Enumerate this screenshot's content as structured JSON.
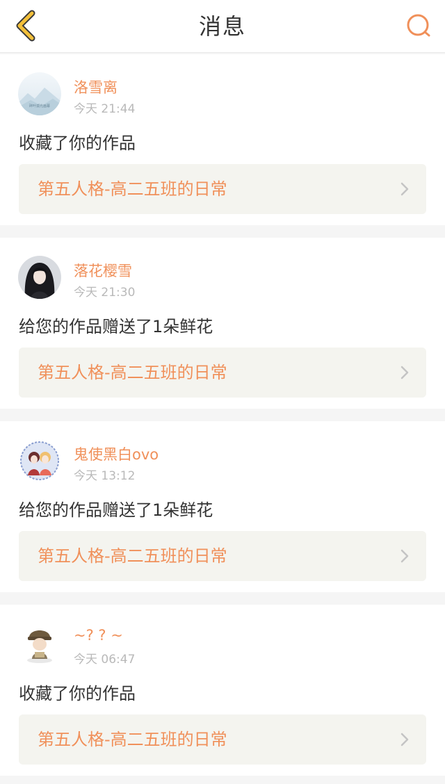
{
  "header": {
    "title": "消息",
    "back_icon": "chevron-left-icon",
    "search_icon": "search-icon",
    "accent_color": "#f0905a",
    "back_color": "#f3c03a"
  },
  "notifications": [
    {
      "username": "洛雪离",
      "time": "今天 21:44",
      "message": "收藏了你的作品",
      "work_title": "第五人格-高二五班的日常",
      "avatar": "avatar-landscape",
      "avatar_text": "碎叶孤光画幕"
    },
    {
      "username": "落花樱雪",
      "time": "今天 21:30",
      "message": "给您的作品赠送了1朵鲜花",
      "work_title": "第五人格-高二五班的日常",
      "avatar": "avatar-dark-hair-girl"
    },
    {
      "username": "鬼使黑白ovo",
      "time": "今天 13:12",
      "message": "给您的作品赠送了1朵鲜花",
      "work_title": "第五人格-高二五班的日常",
      "avatar": "avatar-two-characters"
    },
    {
      "username": "~? ? ~",
      "time": "今天 06:47",
      "message": "收藏了你的作品",
      "work_title": "第五人格-高二五班的日常",
      "avatar": "avatar-chibi-character"
    }
  ]
}
